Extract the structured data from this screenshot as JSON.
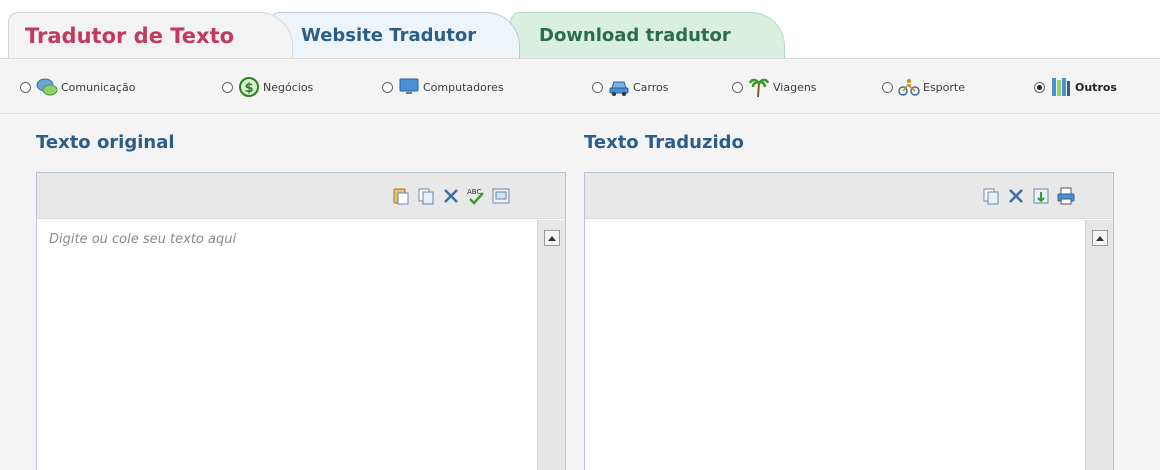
{
  "tabs": [
    {
      "label": "Tradutor de Texto",
      "active": true
    },
    {
      "label": "Website Tradutor",
      "active": false
    },
    {
      "label": "Download tradutor",
      "active": false
    }
  ],
  "categories": [
    {
      "label": "Comunicação",
      "icon": "chat-bubbles-icon",
      "selected": false
    },
    {
      "label": "Negócios",
      "icon": "dollar-coin-icon",
      "selected": false
    },
    {
      "label": "Computadores",
      "icon": "monitor-icon",
      "selected": false
    },
    {
      "label": "Carros",
      "icon": "car-icon",
      "selected": false
    },
    {
      "label": "Viagens",
      "icon": "palm-tree-icon",
      "selected": false
    },
    {
      "label": "Esporte",
      "icon": "bicycle-icon",
      "selected": false
    },
    {
      "label": "Outros",
      "icon": "books-icon",
      "selected": true
    }
  ],
  "source": {
    "title": "Texto original",
    "placeholder": "Digite ou cole seu texto aqui",
    "value": "",
    "tools": [
      "paste-icon",
      "copy-icon",
      "clear-icon",
      "spellcheck-icon",
      "virtual-keyboard-icon"
    ]
  },
  "target": {
    "title": "Texto Traduzido",
    "value": "",
    "tools": [
      "copy-icon",
      "clear-icon",
      "save-icon",
      "print-icon"
    ]
  },
  "colors": {
    "tab_active_text": "#c23a5c",
    "tab_text": "#2b5f8a",
    "tab_download_bg": "#d9efe0",
    "panel_title": "#2a5d8a"
  }
}
